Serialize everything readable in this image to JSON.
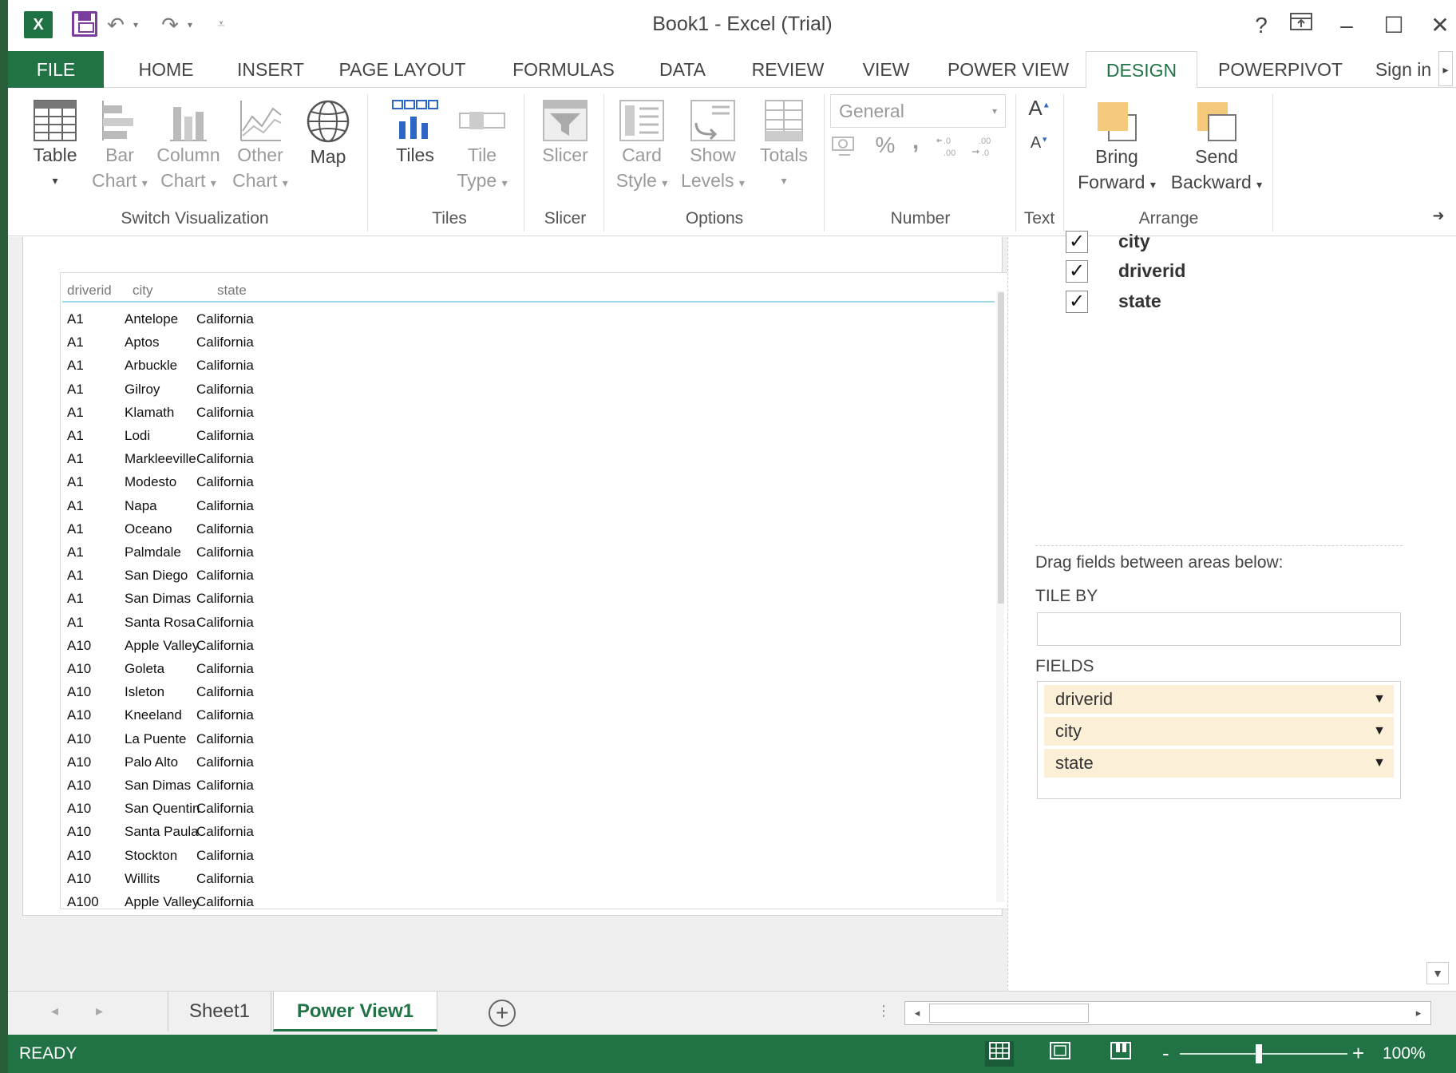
{
  "titlebar": {
    "title": "Book1 - Excel (Trial)",
    "help": "?",
    "restore_ribbon_icon": "ribbon-display-icon",
    "minimize": "–",
    "maximize": "☐",
    "close": "✕",
    "excel_logo_text": "X"
  },
  "tabs": {
    "file": "FILE",
    "home": "HOME",
    "insert": "INSERT",
    "page_layout": "PAGE LAYOUT",
    "formulas": "FORMULAS",
    "data": "DATA",
    "review": "REVIEW",
    "view": "VIEW",
    "power_view": "POWER VIEW",
    "design": "DESIGN",
    "powerpivot": "POWERPIVOT",
    "sign_in": "Sign in"
  },
  "ribbon": {
    "table": "Table",
    "bar_chart_1": "Bar",
    "bar_chart_2": "Chart",
    "column_chart_1": "Column",
    "column_chart_2": "Chart",
    "other_chart_1": "Other",
    "other_chart_2": "Chart",
    "map": "Map",
    "group_switch": "Switch Visualization",
    "tiles": "Tiles",
    "tile_type_1": "Tile",
    "tile_type_2": "Type",
    "group_tiles": "Tiles",
    "slicer": "Slicer",
    "group_slicer": "Slicer",
    "card_style_1": "Card",
    "card_style_2": "Style",
    "show_levels_1": "Show",
    "show_levels_2": "Levels",
    "totals": "Totals",
    "group_options": "Options",
    "number_format": "General",
    "percent": "%",
    "comma": ",",
    "group_number": "Number",
    "font_up": "A",
    "font_down": "A",
    "group_text": "Text",
    "bring_forward_1": "Bring",
    "bring_forward_2": "Forward",
    "send_backward_1": "Send",
    "send_backward_2": "Backward",
    "group_arrange": "Arrange"
  },
  "table": {
    "columns": [
      "driverid",
      "city",
      "state"
    ],
    "rows": [
      [
        "A1",
        "Antelope",
        "California"
      ],
      [
        "A1",
        "Aptos",
        "California"
      ],
      [
        "A1",
        "Arbuckle",
        "California"
      ],
      [
        "A1",
        "Gilroy",
        "California"
      ],
      [
        "A1",
        "Klamath",
        "California"
      ],
      [
        "A1",
        "Lodi",
        "California"
      ],
      [
        "A1",
        "Markleeville",
        "California"
      ],
      [
        "A1",
        "Modesto",
        "California"
      ],
      [
        "A1",
        "Napa",
        "California"
      ],
      [
        "A1",
        "Oceano",
        "California"
      ],
      [
        "A1",
        "Palmdale",
        "California"
      ],
      [
        "A1",
        "San Diego",
        "California"
      ],
      [
        "A1",
        "San Dimas",
        "California"
      ],
      [
        "A1",
        "Santa Rosa",
        "California"
      ],
      [
        "A10",
        "Apple Valley",
        "California"
      ],
      [
        "A10",
        "Goleta",
        "California"
      ],
      [
        "A10",
        "Isleton",
        "California"
      ],
      [
        "A10",
        "Kneeland",
        "California"
      ],
      [
        "A10",
        "La Puente",
        "California"
      ],
      [
        "A10",
        "Palo Alto",
        "California"
      ],
      [
        "A10",
        "San Dimas",
        "California"
      ],
      [
        "A10",
        "San Quentin",
        "California"
      ],
      [
        "A10",
        "Santa Paula",
        "California"
      ],
      [
        "A10",
        "Stockton",
        "California"
      ],
      [
        "A10",
        "Willits",
        "California"
      ],
      [
        "A100",
        "Apple Valley",
        "California"
      ]
    ]
  },
  "field_list": {
    "checked_fields": [
      "city",
      "driverid",
      "state"
    ],
    "check_mark": "✓",
    "drag_hint": "Drag fields between areas below:",
    "tile_by_label": "TILE BY",
    "fields_label": "FIELDS",
    "fields": [
      "driverid",
      "city",
      "state"
    ],
    "dropdown_arrow": "▼"
  },
  "sheet_tabs": {
    "sheet1": "Sheet1",
    "power_view1": "Power View1",
    "add": "+"
  },
  "statusbar": {
    "status": "READY",
    "zoom": "100%",
    "zoom_minus": "-",
    "zoom_plus": "+"
  }
}
